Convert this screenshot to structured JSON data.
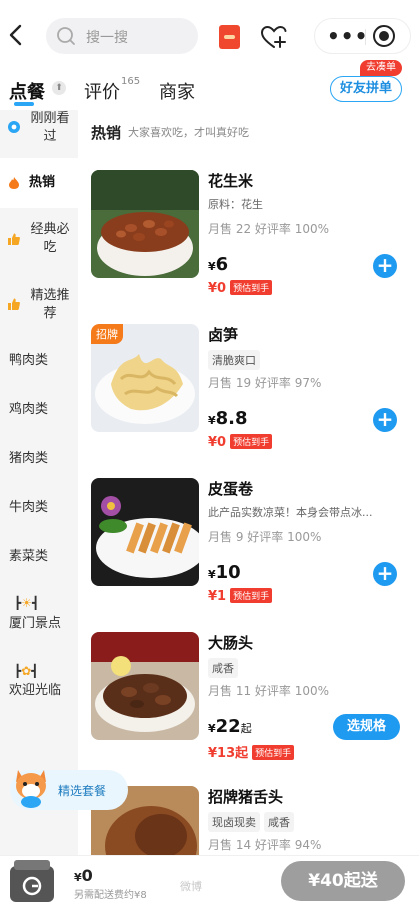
{
  "search": {
    "placeholder": "搜一搜"
  },
  "tabs": [
    {
      "label": "点餐",
      "active": true
    },
    {
      "label": "评价",
      "count": "165"
    },
    {
      "label": "商家"
    }
  ],
  "friend_order": {
    "label": "好友拼单",
    "badge": "去凑单"
  },
  "sidebar": [
    {
      "label": "刚刚看过",
      "icon": "eye-icon"
    },
    {
      "label": "热销",
      "icon": "flame-icon",
      "active": true
    },
    {
      "label": "经典必吃",
      "icon": "thumbs-up-icon"
    },
    {
      "label": "精选推荐",
      "icon": "thumbs-up-icon"
    },
    {
      "label": "鸭肉类"
    },
    {
      "label": "鸡肉类"
    },
    {
      "label": "猪肉类"
    },
    {
      "label": "牛肉类"
    },
    {
      "label": "素菜类"
    },
    {
      "label": "厦门景点",
      "icon": "sun-icon"
    },
    {
      "label": "欢迎光临",
      "icon": "party-popper-icon"
    }
  ],
  "section": {
    "title": "热销",
    "subtitle": "大家喜欢吃，才叫真好吃"
  },
  "products": [
    {
      "name": "花生米",
      "desc": "原料：花生",
      "sales": "月售 22 好评率 100%",
      "price_symbol": "¥",
      "price": "6",
      "est_price": "¥0",
      "est_label": "预估到手",
      "action": "add"
    },
    {
      "name": "卤笋",
      "tags": [
        "清脆爽口"
      ],
      "badge": "招牌",
      "sales": "月售 19 好评率 97%",
      "price_symbol": "¥",
      "price": "8.8",
      "est_price": "¥0",
      "est_label": "预估到手",
      "action": "add"
    },
    {
      "name": "皮蛋卷",
      "desc": "此产品实数凉菜！本身会带点冰...",
      "sales": "月售 9 好评率 100%",
      "price_symbol": "¥",
      "price": "10",
      "est_price": "¥1",
      "est_label": "预估到手",
      "action": "add"
    },
    {
      "name": "大肠头",
      "tags": [
        "咸香"
      ],
      "sales": "月售 11 好评率 100%",
      "price_symbol": "¥",
      "price": "22",
      "price_suffix": "起",
      "est_price": "¥13起",
      "est_label": "预估到手",
      "action": "spec",
      "spec_label": "选规格"
    },
    {
      "name": "招牌猪舌头",
      "tags": [
        "现卤现卖",
        "咸香"
      ],
      "sales": "月售 14 好评率 94%"
    }
  ],
  "combo": {
    "label": "精选套餐"
  },
  "cart": {
    "symbol": "¥",
    "total": "0",
    "delivery_note": "另需配送费约¥8",
    "checkout_label": "¥40起送"
  },
  "watermark": "微博",
  "colors": {
    "accent": "#1e9af0",
    "red": "#f03d2f",
    "sidebar_bg": "#f5f5f5",
    "checkout_disabled": "#9e9e9e"
  }
}
